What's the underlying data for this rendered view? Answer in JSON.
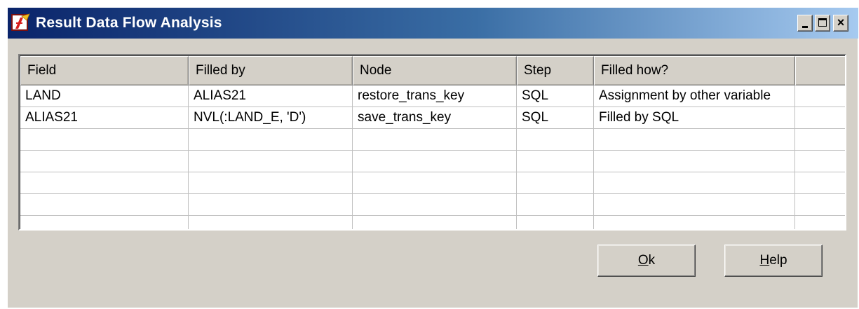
{
  "window": {
    "title": "Result Data Flow Analysis",
    "app_icon": "sql-tool-icon",
    "controls": {
      "minimize": "minimize-icon",
      "maximize": "maximize-icon",
      "close": "×"
    }
  },
  "table": {
    "columns": [
      "Field",
      "Filled by",
      "Node",
      "Step",
      "Filled how?",
      ""
    ],
    "rows": [
      [
        "LAND",
        "ALIAS21",
        "restore_trans_key",
        "SQL",
        "Assignment by other variable",
        ""
      ],
      [
        "ALIAS21",
        "NVL(:LAND_E,   'D')",
        "save_trans_key",
        "SQL",
        "Filled by SQL",
        ""
      ],
      [
        "",
        "",
        "",
        "",
        "",
        ""
      ],
      [
        "",
        "",
        "",
        "",
        "",
        ""
      ],
      [
        "",
        "",
        "",
        "",
        "",
        ""
      ],
      [
        "",
        "",
        "",
        "",
        "",
        ""
      ],
      [
        "",
        "",
        "",
        "",
        "",
        ""
      ]
    ]
  },
  "buttons": {
    "ok": {
      "accel": "O",
      "rest": "k"
    },
    "help": {
      "accel": "H",
      "rest": "elp"
    }
  }
}
